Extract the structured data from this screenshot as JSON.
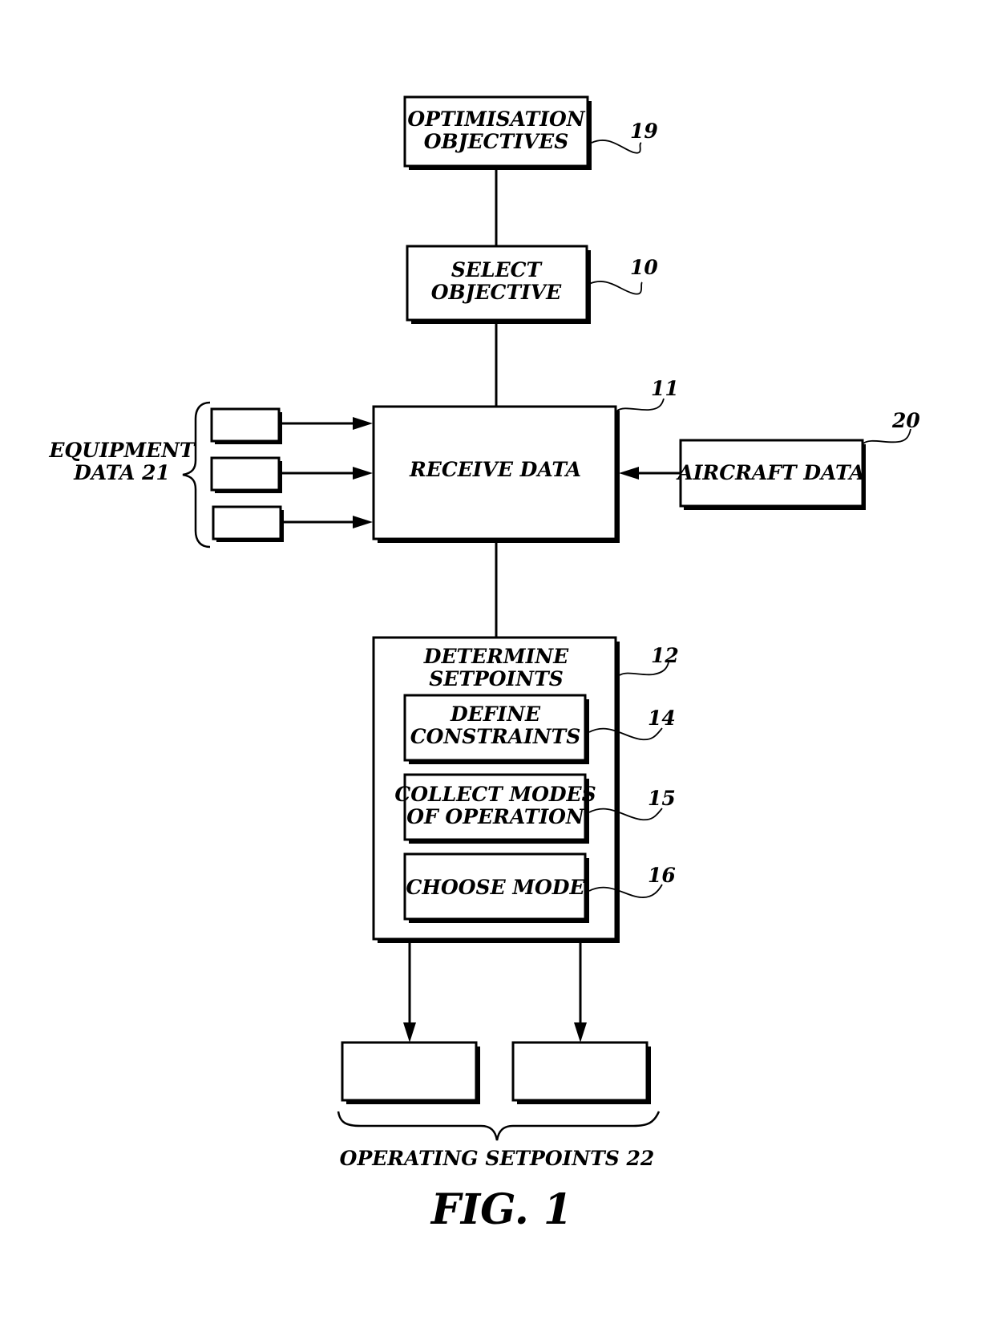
{
  "figure": {
    "caption": "FIG. 1",
    "boxes": {
      "optimisation_objectives": {
        "lines": [
          "OPTIMISATION",
          "OBJECTIVES"
        ],
        "ref": "19"
      },
      "select_objective": {
        "lines": [
          "SELECT",
          "OBJECTIVE"
        ],
        "ref": "10"
      },
      "receive_data": {
        "lines": [
          "RECEIVE DATA"
        ],
        "ref": "11"
      },
      "aircraft_data": {
        "lines": [
          "AIRCRAFT DATA"
        ],
        "ref": "20"
      },
      "determine_setpoints": {
        "lines": [
          "DETERMINE",
          "SETPOINTS"
        ],
        "ref": "12"
      },
      "define_constraints": {
        "lines": [
          "DEFINE",
          "CONSTRAINTS"
        ],
        "ref": "14"
      },
      "collect_modes": {
        "lines": [
          "COLLECT MODES",
          "OF OPERATION"
        ],
        "ref": "15"
      },
      "choose_mode": {
        "lines": [
          "CHOOSE MODE"
        ],
        "ref": "16"
      }
    },
    "groups": {
      "equipment_data": {
        "lines": [
          "EQUIPMENT",
          "DATA 21"
        ],
        "count": 3
      },
      "operating_setpoints": {
        "label": "OPERATING SETPOINTS 22",
        "count": 2
      }
    }
  }
}
